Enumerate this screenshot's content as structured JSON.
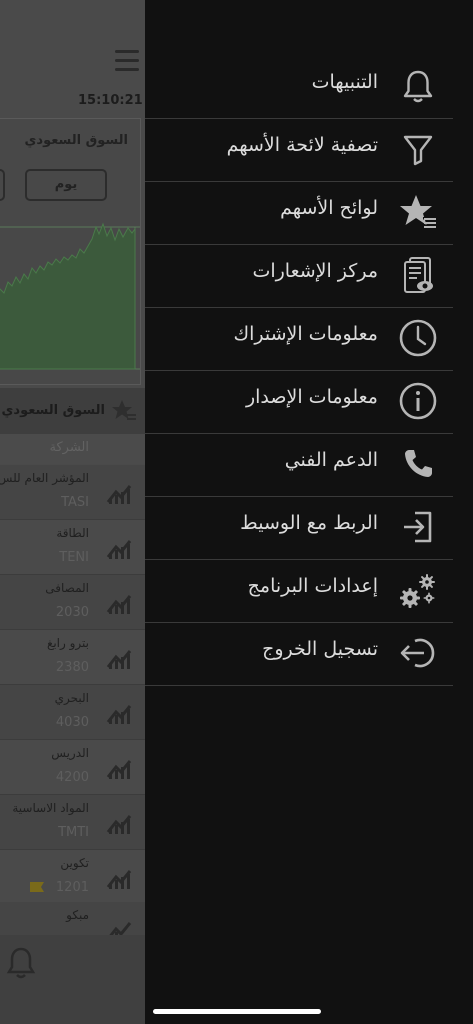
{
  "background": {
    "clock": "15:10:21",
    "market_name": "السوق السعودي",
    "day_button": "يوم",
    "list_title": "السوق السعودي",
    "column_header": "الشركة",
    "stocks": [
      {
        "name": "المؤشر العام للس",
        "code": "TASI"
      },
      {
        "name": "الطاقة",
        "code": "TENI"
      },
      {
        "name": "المصافى",
        "code": "2030"
      },
      {
        "name": "بترو رابغ",
        "code": "2380"
      },
      {
        "name": "البحري",
        "code": "4030"
      },
      {
        "name": "الدريس",
        "code": "4200"
      },
      {
        "name": "المواد الاساسية",
        "code": "TMTI"
      },
      {
        "name": "تكوين",
        "code": "1201"
      },
      {
        "name": "مبكو",
        "code": ""
      }
    ]
  },
  "drawer": {
    "items": [
      {
        "label": "التنبيهات",
        "icon": "bell-icon"
      },
      {
        "label": "تصفية لائحة الأسهم",
        "icon": "filter-icon"
      },
      {
        "label": "لوائح الأسهم",
        "icon": "star-list-icon"
      },
      {
        "label": "مركز الإشعارات",
        "icon": "notification-document-icon"
      },
      {
        "label": "معلومات الإشتراك",
        "icon": "clock-icon"
      },
      {
        "label": "معلومات الإصدار",
        "icon": "info-icon"
      },
      {
        "label": "الدعم الفني",
        "icon": "phone-icon"
      },
      {
        "label": "الربط مع الوسيط",
        "icon": "sign-in-icon"
      },
      {
        "label": "إعدادات البرنامج",
        "icon": "gears-icon"
      },
      {
        "label": "تسجيل الخروج",
        "icon": "logout-icon"
      }
    ]
  },
  "colors": {
    "drawer_bg": "#111111",
    "text": "#dcdcdc",
    "icon": "#b5b5b5",
    "divider": "#3a3a3a",
    "overlay_bg": "#4a4a4a",
    "chart_fill": "#3c5a3c"
  }
}
